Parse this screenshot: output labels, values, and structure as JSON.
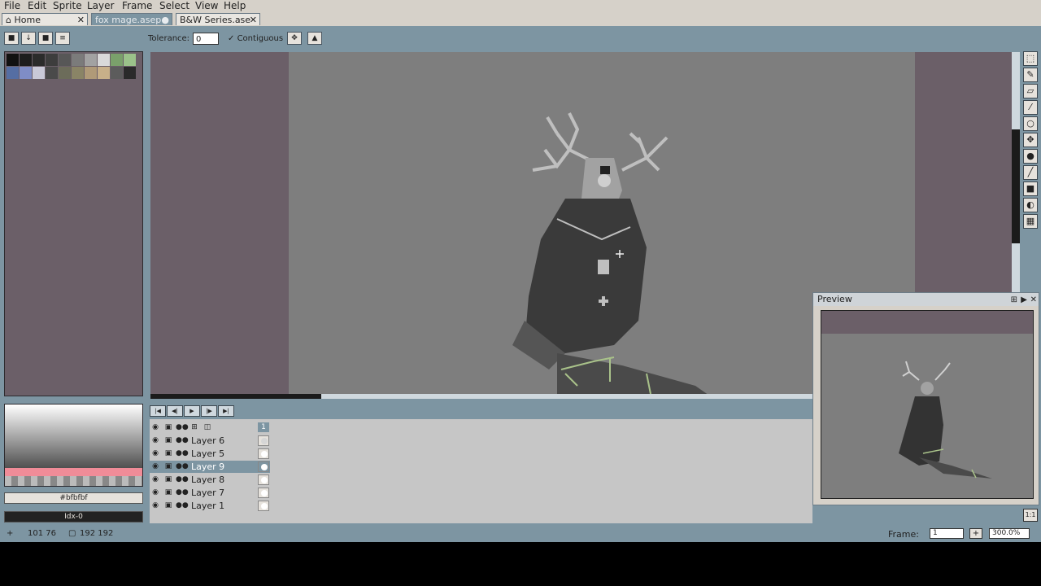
{
  "menu": [
    "File",
    "Edit",
    "Sprite",
    "Layer",
    "Frame",
    "Select",
    "View",
    "Help"
  ],
  "tabs": [
    {
      "label": "Home",
      "icon": "home-icon",
      "close": "✕"
    },
    {
      "label": "fox mage.asep",
      "modified": "●"
    },
    {
      "label": "B&W Series.ase",
      "close": "✕"
    }
  ],
  "toolbar": {
    "tolerance_label": "Tolerance:",
    "tolerance_value": "0",
    "contiguous_label": "Contiguous",
    "contiguous_check": "✓"
  },
  "palette": {
    "colors": [
      "#111111",
      "#1d1d1d",
      "#2b2b2b",
      "#3d3d3d",
      "#575757",
      "#7b7b7b",
      "#a2a2a2",
      "#d9d9d9",
      "#7aa06b",
      "#9bc28a",
      "#556ea3",
      "#7f8dc6",
      "#c9c9d8",
      "#4a4a4a",
      "#6c6c5a",
      "#8a8466",
      "#b09a78",
      "#c8b089",
      "#5c5c5c",
      "#2a2a2a"
    ]
  },
  "color": {
    "hex": "#bfbfbf",
    "index": "Idx-0"
  },
  "layers": [
    {
      "name": "Layer 6",
      "active": false
    },
    {
      "name": "Layer 5",
      "active": false
    },
    {
      "name": "Layer 9",
      "active": true
    },
    {
      "name": "Layer 8",
      "active": false
    },
    {
      "name": "Layer 7",
      "active": false
    },
    {
      "name": "Layer 1",
      "active": false
    }
  ],
  "timeline": {
    "frame_header": "1"
  },
  "preview": {
    "title": "Preview"
  },
  "status": {
    "cursor_pos": "101 76",
    "sprite_size": "192 192",
    "frame_label": "Frame:",
    "frame_value": "1",
    "zoom": "300.0%"
  },
  "colors": {
    "workspace": "#7d95a2",
    "canvas_bg": "#6b5f68",
    "sprite_bg": "#7e7e7e",
    "active_layer": "#7d95a2",
    "accent_pink": "#f08c98"
  }
}
